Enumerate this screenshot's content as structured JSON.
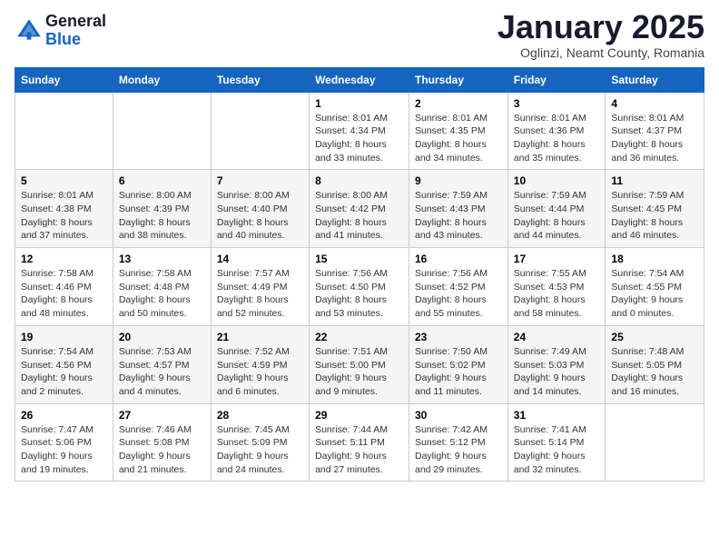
{
  "header": {
    "logo_line1": "General",
    "logo_line2": "Blue",
    "month_title": "January 2025",
    "location": "Oglinzi, Neamt County, Romania"
  },
  "days_of_week": [
    "Sunday",
    "Monday",
    "Tuesday",
    "Wednesday",
    "Thursday",
    "Friday",
    "Saturday"
  ],
  "weeks": [
    [
      {
        "day": "",
        "info": ""
      },
      {
        "day": "",
        "info": ""
      },
      {
        "day": "",
        "info": ""
      },
      {
        "day": "1",
        "info": "Sunrise: 8:01 AM\nSunset: 4:34 PM\nDaylight: 8 hours\nand 33 minutes."
      },
      {
        "day": "2",
        "info": "Sunrise: 8:01 AM\nSunset: 4:35 PM\nDaylight: 8 hours\nand 34 minutes."
      },
      {
        "day": "3",
        "info": "Sunrise: 8:01 AM\nSunset: 4:36 PM\nDaylight: 8 hours\nand 35 minutes."
      },
      {
        "day": "4",
        "info": "Sunrise: 8:01 AM\nSunset: 4:37 PM\nDaylight: 8 hours\nand 36 minutes."
      }
    ],
    [
      {
        "day": "5",
        "info": "Sunrise: 8:01 AM\nSunset: 4:38 PM\nDaylight: 8 hours\nand 37 minutes."
      },
      {
        "day": "6",
        "info": "Sunrise: 8:00 AM\nSunset: 4:39 PM\nDaylight: 8 hours\nand 38 minutes."
      },
      {
        "day": "7",
        "info": "Sunrise: 8:00 AM\nSunset: 4:40 PM\nDaylight: 8 hours\nand 40 minutes."
      },
      {
        "day": "8",
        "info": "Sunrise: 8:00 AM\nSunset: 4:42 PM\nDaylight: 8 hours\nand 41 minutes."
      },
      {
        "day": "9",
        "info": "Sunrise: 7:59 AM\nSunset: 4:43 PM\nDaylight: 8 hours\nand 43 minutes."
      },
      {
        "day": "10",
        "info": "Sunrise: 7:59 AM\nSunset: 4:44 PM\nDaylight: 8 hours\nand 44 minutes."
      },
      {
        "day": "11",
        "info": "Sunrise: 7:59 AM\nSunset: 4:45 PM\nDaylight: 8 hours\nand 46 minutes."
      }
    ],
    [
      {
        "day": "12",
        "info": "Sunrise: 7:58 AM\nSunset: 4:46 PM\nDaylight: 8 hours\nand 48 minutes."
      },
      {
        "day": "13",
        "info": "Sunrise: 7:58 AM\nSunset: 4:48 PM\nDaylight: 8 hours\nand 50 minutes."
      },
      {
        "day": "14",
        "info": "Sunrise: 7:57 AM\nSunset: 4:49 PM\nDaylight: 8 hours\nand 52 minutes."
      },
      {
        "day": "15",
        "info": "Sunrise: 7:56 AM\nSunset: 4:50 PM\nDaylight: 8 hours\nand 53 minutes."
      },
      {
        "day": "16",
        "info": "Sunrise: 7:56 AM\nSunset: 4:52 PM\nDaylight: 8 hours\nand 55 minutes."
      },
      {
        "day": "17",
        "info": "Sunrise: 7:55 AM\nSunset: 4:53 PM\nDaylight: 8 hours\nand 58 minutes."
      },
      {
        "day": "18",
        "info": "Sunrise: 7:54 AM\nSunset: 4:55 PM\nDaylight: 9 hours\nand 0 minutes."
      }
    ],
    [
      {
        "day": "19",
        "info": "Sunrise: 7:54 AM\nSunset: 4:56 PM\nDaylight: 9 hours\nand 2 minutes."
      },
      {
        "day": "20",
        "info": "Sunrise: 7:53 AM\nSunset: 4:57 PM\nDaylight: 9 hours\nand 4 minutes."
      },
      {
        "day": "21",
        "info": "Sunrise: 7:52 AM\nSunset: 4:59 PM\nDaylight: 9 hours\nand 6 minutes."
      },
      {
        "day": "22",
        "info": "Sunrise: 7:51 AM\nSunset: 5:00 PM\nDaylight: 9 hours\nand 9 minutes."
      },
      {
        "day": "23",
        "info": "Sunrise: 7:50 AM\nSunset: 5:02 PM\nDaylight: 9 hours\nand 11 minutes."
      },
      {
        "day": "24",
        "info": "Sunrise: 7:49 AM\nSunset: 5:03 PM\nDaylight: 9 hours\nand 14 minutes."
      },
      {
        "day": "25",
        "info": "Sunrise: 7:48 AM\nSunset: 5:05 PM\nDaylight: 9 hours\nand 16 minutes."
      }
    ],
    [
      {
        "day": "26",
        "info": "Sunrise: 7:47 AM\nSunset: 5:06 PM\nDaylight: 9 hours\nand 19 minutes."
      },
      {
        "day": "27",
        "info": "Sunrise: 7:46 AM\nSunset: 5:08 PM\nDaylight: 9 hours\nand 21 minutes."
      },
      {
        "day": "28",
        "info": "Sunrise: 7:45 AM\nSunset: 5:09 PM\nDaylight: 9 hours\nand 24 minutes."
      },
      {
        "day": "29",
        "info": "Sunrise: 7:44 AM\nSunset: 5:11 PM\nDaylight: 9 hours\nand 27 minutes."
      },
      {
        "day": "30",
        "info": "Sunrise: 7:42 AM\nSunset: 5:12 PM\nDaylight: 9 hours\nand 29 minutes."
      },
      {
        "day": "31",
        "info": "Sunrise: 7:41 AM\nSunset: 5:14 PM\nDaylight: 9 hours\nand 32 minutes."
      },
      {
        "day": "",
        "info": ""
      }
    ]
  ]
}
